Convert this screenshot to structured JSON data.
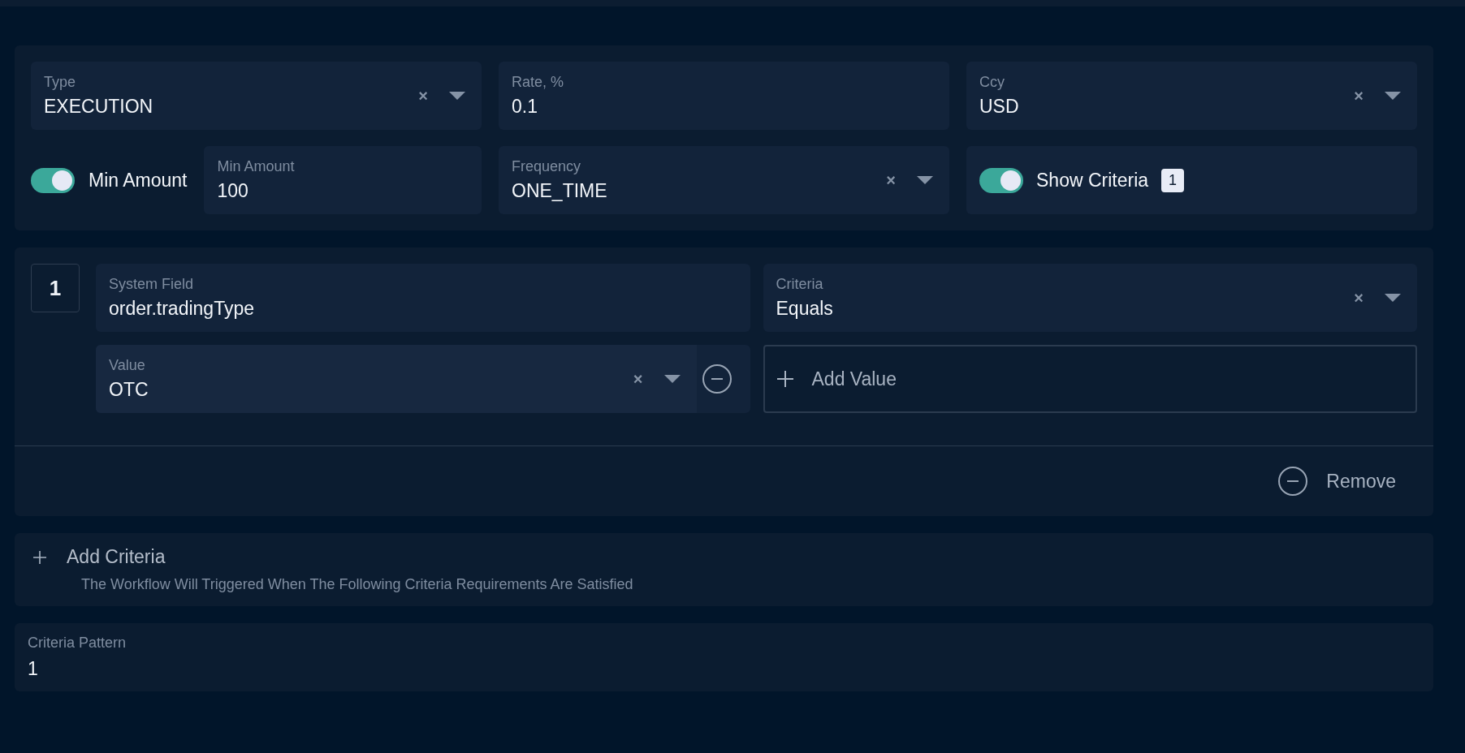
{
  "settings": {
    "fields_row1": [
      {
        "kind": "select",
        "label": "Type",
        "value": "EXECUTION",
        "clear": "×"
      },
      {
        "kind": "input",
        "label": "Rate, %",
        "value": "0.1"
      },
      {
        "kind": "select",
        "label": "Ccy",
        "value": "USD",
        "clear": "×"
      }
    ],
    "min_amount_toggle": {
      "label": "Min Amount",
      "on": true
    },
    "min_amount": {
      "label": "Min Amount",
      "value": "100"
    },
    "frequency": {
      "label": "Frequency",
      "value": "ONE_TIME",
      "clear": "×"
    },
    "show_criteria": {
      "label": "Show Criteria",
      "on": true,
      "count": "1"
    }
  },
  "criteria": [
    {
      "number": "1",
      "system_field": {
        "label": "System Field",
        "value": "order.tradingType"
      },
      "criteria": {
        "label": "Criteria",
        "value": "Equals",
        "clear": "×"
      },
      "values": [
        {
          "label": "Value",
          "value": "OTC",
          "clear": "×"
        }
      ],
      "add_value": "Add Value",
      "remove": "Remove"
    }
  ],
  "add_criteria": {
    "label": "Add Criteria",
    "hint": "The Workflow Will Triggered When The Following Criteria Requirements Are Satisfied"
  },
  "criteria_pattern": {
    "label": "Criteria Pattern",
    "value": "1"
  }
}
